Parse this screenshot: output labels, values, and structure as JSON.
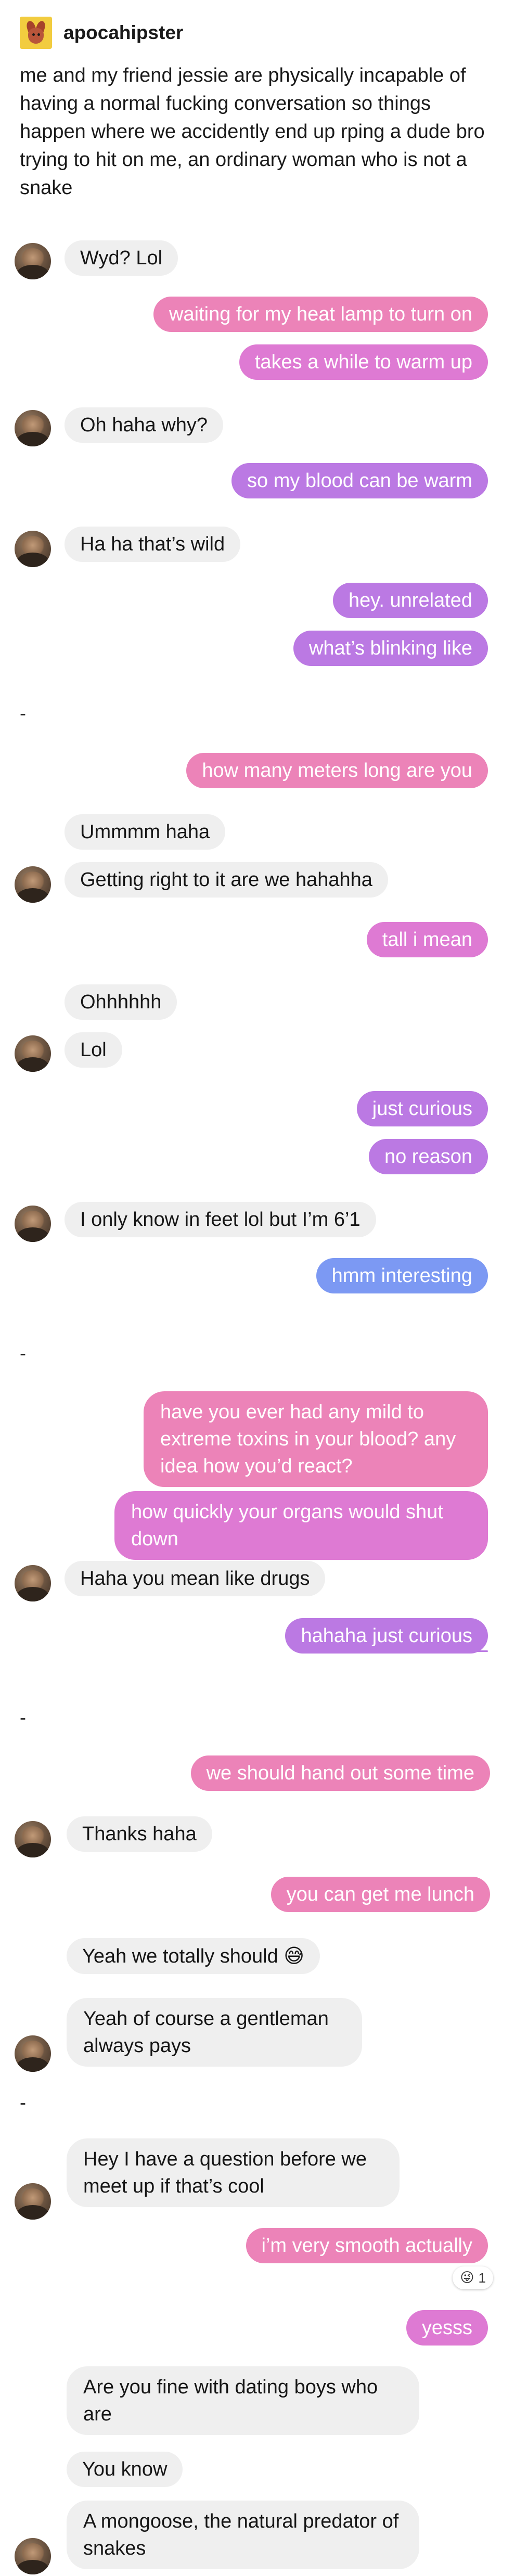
{
  "post": {
    "username": "apocahipster",
    "text": "me and my friend jessie are physically incapable of having a normal fucking conversation so things happen where we accidently end up rping a dude bro trying to hit on me, an ordinary woman who is not a snake"
  },
  "messages": {
    "s1": {
      "m1": "Wyd? Lol",
      "m2": "waiting for my heat lamp to turn on",
      "m3": "takes a while to warm up",
      "m4": "Oh haha why?",
      "m5": "so my blood can be warm",
      "m6": "Ha ha that’s wild",
      "m7": "hey. unrelated",
      "m8": "what’s blinking like"
    },
    "s2": {
      "divider": "-",
      "m1": "how many meters long are you",
      "m2": "Ummmm haha",
      "m3": "Getting right to it are we hahahha",
      "m4": "tall i mean",
      "m5": "Ohhhhhh",
      "m6": "Lol",
      "m7": "just curious",
      "m8": "no reason",
      "m9": "I only know in feet lol but I’m 6’1",
      "m10": "hmm interesting"
    },
    "s3": {
      "divider": "-",
      "m1": "have you ever had any mild to extreme toxins in your blood? any idea how you’d react?",
      "m2": "how quickly your organs would shut down",
      "m3": "Haha you mean like drugs",
      "m4": "hahaha just curious"
    },
    "s4": {
      "divider": "-",
      "m1": "we should hand out some time",
      "m2": "Thanks haha",
      "m3": "you can get me lunch",
      "m4_text": "Yeah we totally should",
      "m4_emoji": "😅",
      "m5": "Yeah of course a gentleman always pays"
    },
    "s5": {
      "divider": "-",
      "m1": "Hey I have a question before we meet up if that’s cool",
      "m2": "i’m very smooth actually",
      "m2_reaction_emoji": "😜",
      "m2_reaction_count": "1",
      "m3": "yesss",
      "m4": "Are you fine with dating boys who are",
      "m5": "You know",
      "m6": "A mongoose, the natural predator of snakes"
    }
  },
  "colors": {
    "incoming": "#efefef",
    "outgoing_pink": "#ec83b8",
    "outgoing_orchid": "#de7ad3",
    "outgoing_purple": "#bb79e3",
    "outgoing_blue": "#7c99f3",
    "header_avatar": "#f2cc3f"
  },
  "icons": {
    "header_avatar": "anteater-avatar-icon",
    "contact_avatar": "contact-avatar-icon",
    "reaction": "winking-tongue-emoji-icon"
  }
}
